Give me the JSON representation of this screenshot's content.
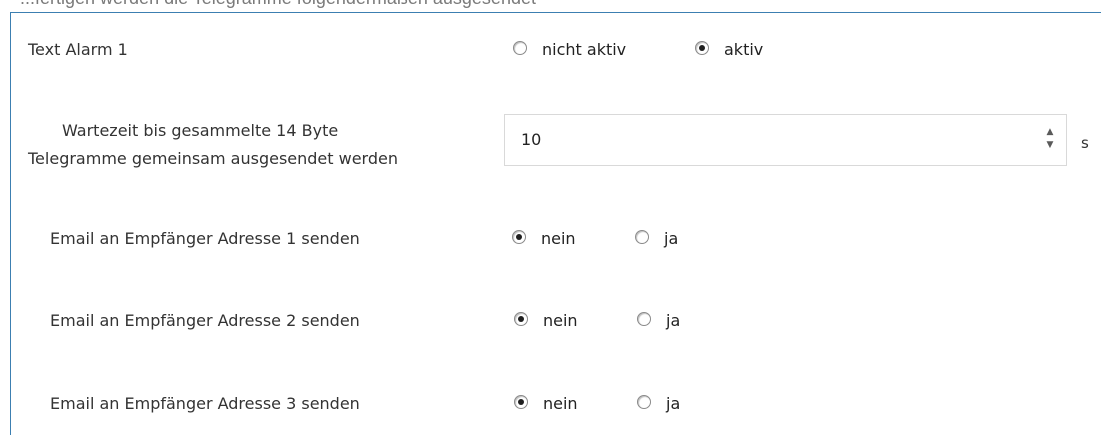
{
  "header_fragment": "...fertigen werden die Telegramme folgendermaßen ausgesendet",
  "text_alarm": {
    "label": "Text Alarm 1",
    "option_off": "nicht aktiv",
    "option_on": "aktiv",
    "selected": "aktiv"
  },
  "wait_time": {
    "label_line1": "Wartezeit bis gesammelte 14 Byte",
    "label_line2": "Telegramme gemeinsam ausgesendet werden",
    "value": "10",
    "unit": "s",
    "up_icon": "▲",
    "down_icon": "▼"
  },
  "email_rows": [
    {
      "label": "Email an Empfänger Adresse 1 senden",
      "option_no": "nein",
      "option_yes": "ja",
      "selected": "nein"
    },
    {
      "label": "Email an Empfänger Adresse 2 senden",
      "option_no": "nein",
      "option_yes": "ja",
      "selected": "nein"
    },
    {
      "label": "Email an Empfänger Adresse 3 senden",
      "option_no": "nein",
      "option_yes": "ja",
      "selected": "nein"
    }
  ],
  "colors": {
    "panel_border": "#3c7fb1",
    "text": "#333333"
  }
}
